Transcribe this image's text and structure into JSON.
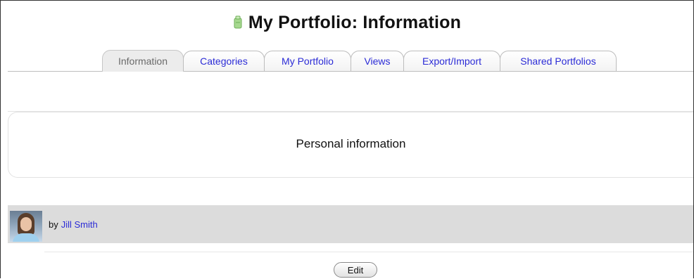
{
  "page": {
    "title": "My Portfolio: Information",
    "title_icon": "portfolio-icon"
  },
  "tabs": [
    {
      "label": "Information",
      "active": true
    },
    {
      "label": "Categories",
      "active": false
    },
    {
      "label": "My Portfolio",
      "active": false
    },
    {
      "label": "Views",
      "active": false
    },
    {
      "label": "Export/Import",
      "active": false
    },
    {
      "label": "Shared Portfolios",
      "active": false
    }
  ],
  "content": {
    "section_title": "Personal information"
  },
  "author": {
    "prefix": "by",
    "name": "Jill Smith",
    "avatar": "user-avatar"
  },
  "actions": {
    "edit_label": "Edit"
  },
  "colors": {
    "link": "#2b2bd6",
    "active_tab": "#ececec",
    "author_row": "#dcdcdc"
  }
}
